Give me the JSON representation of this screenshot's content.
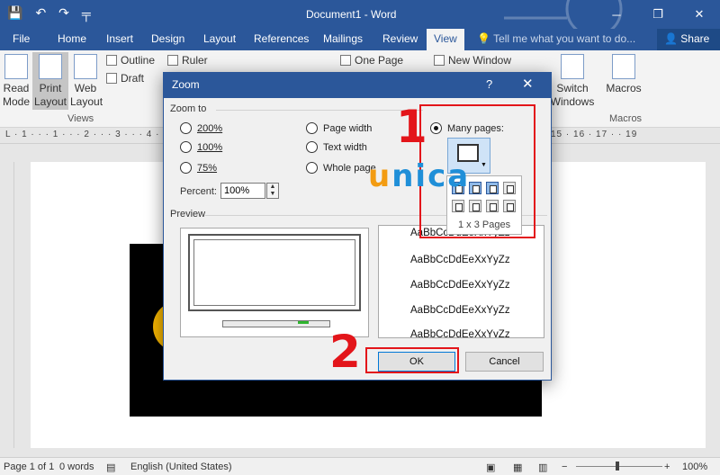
{
  "window": {
    "title": "Document1 - Word",
    "controls": {
      "minimize": "─",
      "restore": "❐",
      "close": "✕"
    }
  },
  "qat": {
    "save": "💾",
    "undo": "↶",
    "redo": "↷",
    "customize": "╤"
  },
  "tabs": [
    {
      "label": "File"
    },
    {
      "label": "Home"
    },
    {
      "label": "Insert"
    },
    {
      "label": "Design"
    },
    {
      "label": "Layout"
    },
    {
      "label": "References"
    },
    {
      "label": "Mailings"
    },
    {
      "label": "Review"
    },
    {
      "label": "View"
    }
  ],
  "tell_me": "Tell me what you want to do...",
  "share": "Share",
  "ribbon": {
    "read_mode": "Read Mode",
    "print_layout": "Print Layout",
    "web_layout": "Web Layout",
    "outline": "Outline",
    "draft": "Draft",
    "views_label": "Views",
    "ruler": "Ruler",
    "one_page": "One Page",
    "new_window": "New Window",
    "switch_windows": "Switch Windows",
    "macros": "Macros",
    "macros_label": "Macros"
  },
  "ruler": {
    "horizontal": "L · 1 · · · 1 · · · 2 · · · 3 · · · 4 · · · 5",
    "right_ticks": "15 · 16 · 17 · · 19"
  },
  "dialog": {
    "title": "Zoom",
    "help": "?",
    "close": "✕",
    "zoom_to": "Zoom to",
    "options": {
      "p200": "200%",
      "p100": "100%",
      "p75": "75%",
      "page_width": "Page width",
      "text_width": "Text width",
      "whole_page": "Whole page",
      "many_pages": "Many pages:"
    },
    "selected": "many_pages",
    "percent_label": "Percent:",
    "percent_value": "100%",
    "preview_label": "Preview",
    "preview_lines": [
      "AaBbCcDdEeXxYyZz",
      "AaBbCcDdEeXxYyZz",
      "AaBbCcDdEeXxYyZz",
      "AaBbCcDdEeXxYyZz",
      "AaBbCcDdEeXxYyZz"
    ],
    "pages_caption": "1 x 3 Pages",
    "ok": "OK",
    "cancel": "Cancel"
  },
  "annotations": {
    "step1": "1",
    "step2": "2",
    "logo_part1": "u",
    "logo_part2": "nica",
    "accent": "#e3151a"
  },
  "status": {
    "page": "Page 1 of 1",
    "words": "0 words",
    "language": "English (United States)",
    "zoom": "100%"
  }
}
